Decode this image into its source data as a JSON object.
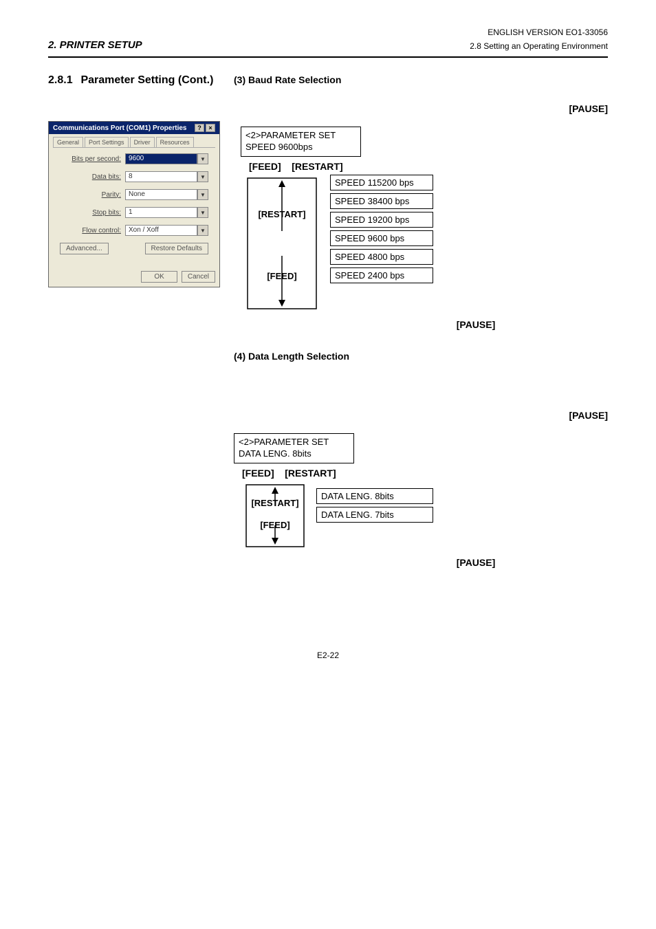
{
  "header": {
    "left": "2. PRINTER SETUP",
    "right_top": "ENGLISH VERSION EO1-33056",
    "right_sub": "2.8 Setting an Operating Environment"
  },
  "left_heading": {
    "num": "2.8.1",
    "title": "Parameter Setting (Cont.)"
  },
  "dialog": {
    "title": "Communications Port (COM1) Properties",
    "tabs": [
      "General",
      "Port Settings",
      "Driver",
      "Resources"
    ],
    "fields": {
      "bps_label": "Bits per second:",
      "bps_value": "9600",
      "data_bits_label": "Data bits:",
      "data_bits_value": "8",
      "parity_label": "Parity:",
      "parity_value": "None",
      "stop_bits_label": "Stop bits:",
      "stop_bits_value": "1",
      "flow_label": "Flow control:",
      "flow_value": "Xon / Xoff"
    },
    "buttons": {
      "advanced": "Advanced...",
      "restore": "Restore Defaults",
      "ok": "OK",
      "cancel": "Cancel"
    }
  },
  "section3": {
    "heading": "(3)  Baud Rate Selection",
    "pause_top": "[PAUSE]",
    "lcd_line1": "<2>PARAMETER SET",
    "lcd_line2": "SPEED   9600bps",
    "feed_label": "[FEED]",
    "restart_label": "[RESTART]",
    "restart_side": "[RESTART]",
    "feed_side": "[FEED]",
    "options": [
      "SPEED  115200 bps",
      "SPEED  38400 bps",
      "SPEED  19200 bps",
      "SPEED   9600 bps",
      "SPEED   4800 bps",
      "SPEED   2400 bps"
    ],
    "pause_bottom": "[PAUSE]"
  },
  "section4": {
    "heading": "(4)  Data Length Selection",
    "pause_top": "[PAUSE]",
    "lcd_line1": "<2>PARAMETER SET",
    "lcd_line2": "DATA LENG. 8bits",
    "feed_label": "[FEED]",
    "restart_label": "[RESTART]",
    "restart_side": "[RESTART]",
    "feed_side": "[FEED]",
    "options": [
      "DATA LENG. 8bits",
      "DATA LENG. 7bits"
    ],
    "pause_bottom": "[PAUSE]"
  },
  "footer_page": "E2-22"
}
